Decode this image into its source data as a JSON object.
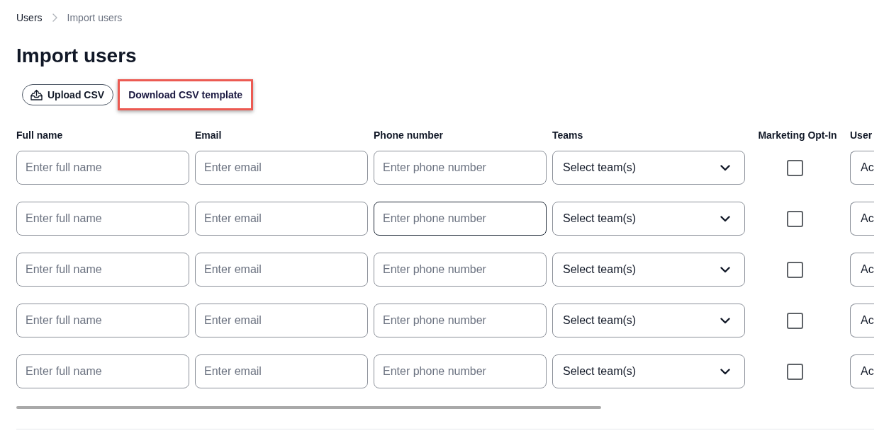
{
  "breadcrumb": [
    {
      "label": "Users",
      "current": false
    },
    {
      "label": "Import users",
      "current": true
    }
  ],
  "title": "Import users",
  "actions": [
    {
      "kind": "outlined",
      "label": "Upload CSV",
      "highlighted": false
    },
    {
      "kind": "plain",
      "label": "Download CSV template",
      "highlighted": true
    }
  ],
  "table": {
    "columns": [
      "Full name",
      "Email",
      "Phone number",
      "Teams",
      "Marketing Opt-In",
      "User"
    ],
    "rows": [
      {
        "full_name": {
          "placeholder": "Enter full name"
        },
        "email": {
          "placeholder": "Enter email"
        },
        "phone": {
          "placeholder": "Enter phone number",
          "focused": false
        },
        "teams": {
          "value": "Select team(s)"
        },
        "marketing_opt_in": {
          "checked": false
        },
        "column_6": {
          "value": "Ac"
        }
      },
      {
        "full_name": {
          "placeholder": "Enter full name"
        },
        "email": {
          "placeholder": "Enter email"
        },
        "phone": {
          "placeholder": "Enter phone number",
          "focused": true
        },
        "teams": {
          "value": "Select team(s)"
        },
        "marketing_opt_in": {
          "checked": false
        },
        "column_6": {
          "value": "Ac"
        }
      },
      {
        "full_name": {
          "placeholder": "Enter full name"
        },
        "email": {
          "placeholder": "Enter email"
        },
        "phone": {
          "placeholder": "Enter phone number",
          "focused": false
        },
        "teams": {
          "value": "Select team(s)"
        },
        "marketing_opt_in": {
          "checked": false
        },
        "column_6": {
          "value": "Ac"
        }
      },
      {
        "full_name": {
          "placeholder": "Enter full name"
        },
        "email": {
          "placeholder": "Enter email"
        },
        "phone": {
          "placeholder": "Enter phone number",
          "focused": false
        },
        "teams": {
          "value": "Select team(s)"
        },
        "marketing_opt_in": {
          "checked": false
        },
        "column_6": {
          "value": "Ac"
        }
      },
      {
        "full_name": {
          "placeholder": "Enter full name"
        },
        "email": {
          "placeholder": "Enter email"
        },
        "phone": {
          "placeholder": "Enter phone number",
          "focused": false
        },
        "teams": {
          "value": "Select team(s)"
        },
        "marketing_opt_in": {
          "checked": false
        },
        "column_6": {
          "value": "Ac"
        }
      }
    ]
  }
}
